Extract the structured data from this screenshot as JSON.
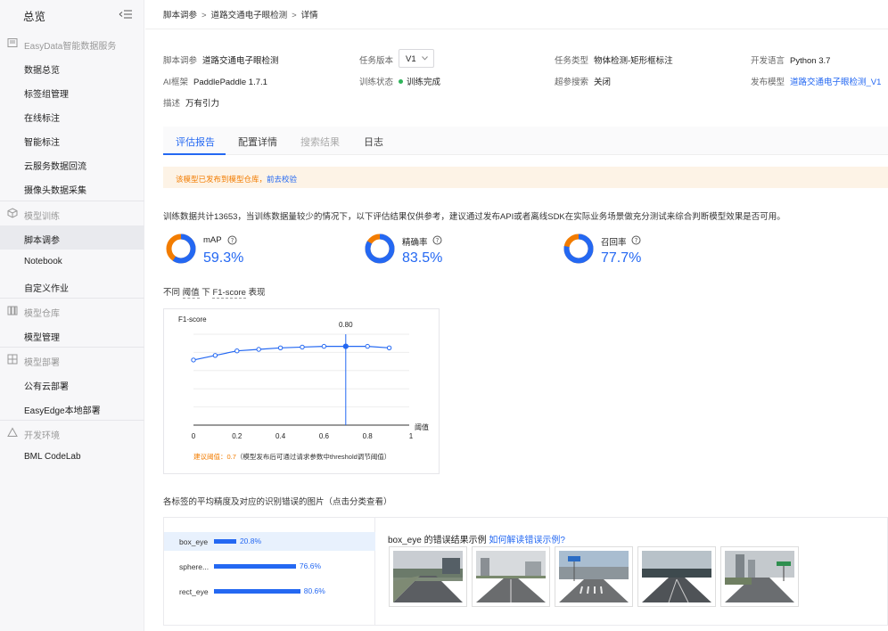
{
  "sidebar": {
    "title": "总览",
    "groups": [
      {
        "label": "EasyData智能数据服务",
        "icon": "data-service-icon",
        "items": [
          {
            "label": "数据总览"
          },
          {
            "label": "标签组管理"
          },
          {
            "label": "在线标注"
          },
          {
            "label": "智能标注"
          },
          {
            "label": "云服务数据回流"
          },
          {
            "label": "摄像头数据采集"
          }
        ]
      },
      {
        "label": "模型训练",
        "icon": "cube-icon",
        "items": [
          {
            "label": "脚本调参",
            "active": true
          },
          {
            "label": "Notebook"
          },
          {
            "label": "自定义作业"
          }
        ]
      },
      {
        "label": "模型仓库",
        "icon": "warehouse-icon",
        "items": [
          {
            "label": "模型管理"
          }
        ]
      },
      {
        "label": "模型部署",
        "icon": "deploy-icon",
        "items": [
          {
            "label": "公有云部署"
          },
          {
            "label": "EasyEdge本地部署"
          }
        ]
      },
      {
        "label": "开发环境",
        "icon": "triangle-icon",
        "items": [
          {
            "label": "BML CodeLab"
          }
        ]
      }
    ]
  },
  "breadcrumb": [
    "脚本调参",
    "道路交通电子眼检测",
    "详情"
  ],
  "info": {
    "script_label": "脚本调参",
    "script_value": "道路交通电子眼检测",
    "version_label": "任务版本",
    "version_value": "V1",
    "task_type_label": "任务类型",
    "task_type_value": "物体检测-矩形框标注",
    "lang_label": "开发语言",
    "lang_value": "Python 3.7",
    "framework_label": "AI框架",
    "framework_value": "PaddlePaddle 1.7.1",
    "status_label": "训练状态",
    "status_value": "训练完成",
    "hyper_label": "超参搜索",
    "hyper_value": "关闭",
    "publish_label": "发布模型",
    "publish_value": "道路交通电子眼检测_V1",
    "desc_label": "描述",
    "desc_value": "万有引力"
  },
  "tabs": [
    {
      "label": "评估报告",
      "state": "active"
    },
    {
      "label": "配置详情",
      "state": "normal"
    },
    {
      "label": "搜索结果",
      "state": "disabled"
    },
    {
      "label": "日志",
      "state": "normal"
    }
  ],
  "notice": {
    "text": "该模型已发布到模型仓库，",
    "link": "前去校验"
  },
  "summary": "训练数据共计13653，当训练数据量较少的情况下，以下评估结果仅供参考，建议通过发布API或者离线SDK在实际业务场景做充分测试来综合判断模型效果是否可用。",
  "metrics": [
    {
      "name": "mAP",
      "value": "59.3%",
      "fraction": 0.593
    },
    {
      "name": "精确率",
      "value": "83.5%",
      "fraction": 0.835
    },
    {
      "name": "召回率",
      "value": "77.7%",
      "fraction": 0.777
    }
  ],
  "f1_title": {
    "prefix": "不同 ",
    "threshold": "阈值",
    "mid": " 下 ",
    "metric": "F1-score",
    "suffix": " 表现"
  },
  "chart_data": {
    "type": "line",
    "ylabel": "F1-score",
    "xlabel": "阈值",
    "xlim": [
      0,
      1
    ],
    "x_ticks": [
      "0",
      "0.2",
      "0.4",
      "0.6",
      "0.8",
      "1"
    ],
    "grid": true,
    "x": [
      0.0,
      0.1,
      0.2,
      0.3,
      0.4,
      0.5,
      0.6,
      0.7,
      0.8,
      0.9
    ],
    "values": [
      0.43,
      0.46,
      0.49,
      0.5,
      0.51,
      0.515,
      0.52,
      0.52,
      0.52,
      0.51
    ],
    "ylim": [
      0,
      0.6
    ],
    "highlight": {
      "x": 0.7,
      "label": "0.80"
    },
    "suggest_label": "建议阈值：",
    "suggest_value": "0.7",
    "suggest_note": "（模型发布后可通过请求参数中threshold调节阈值）"
  },
  "section_title": "各标签的平均精度及对应的识别错误的图片（点击分类查看）",
  "labels": [
    {
      "name": "box_eye",
      "percent": "20.8%",
      "value": 0.208,
      "active": true
    },
    {
      "name": "sphere...",
      "percent": "76.6%",
      "value": 0.766,
      "active": false
    },
    {
      "name": "rect_eye",
      "percent": "80.6%",
      "value": 0.806,
      "active": false
    }
  ],
  "error_header": {
    "title": "box_eye 的错误结果示例",
    "link": "如何解读错误示例?"
  },
  "colors": {
    "accent": "#2468f2",
    "ring_track": "#f27c00",
    "warning": "#f27c00",
    "success": "#2fb45a"
  }
}
